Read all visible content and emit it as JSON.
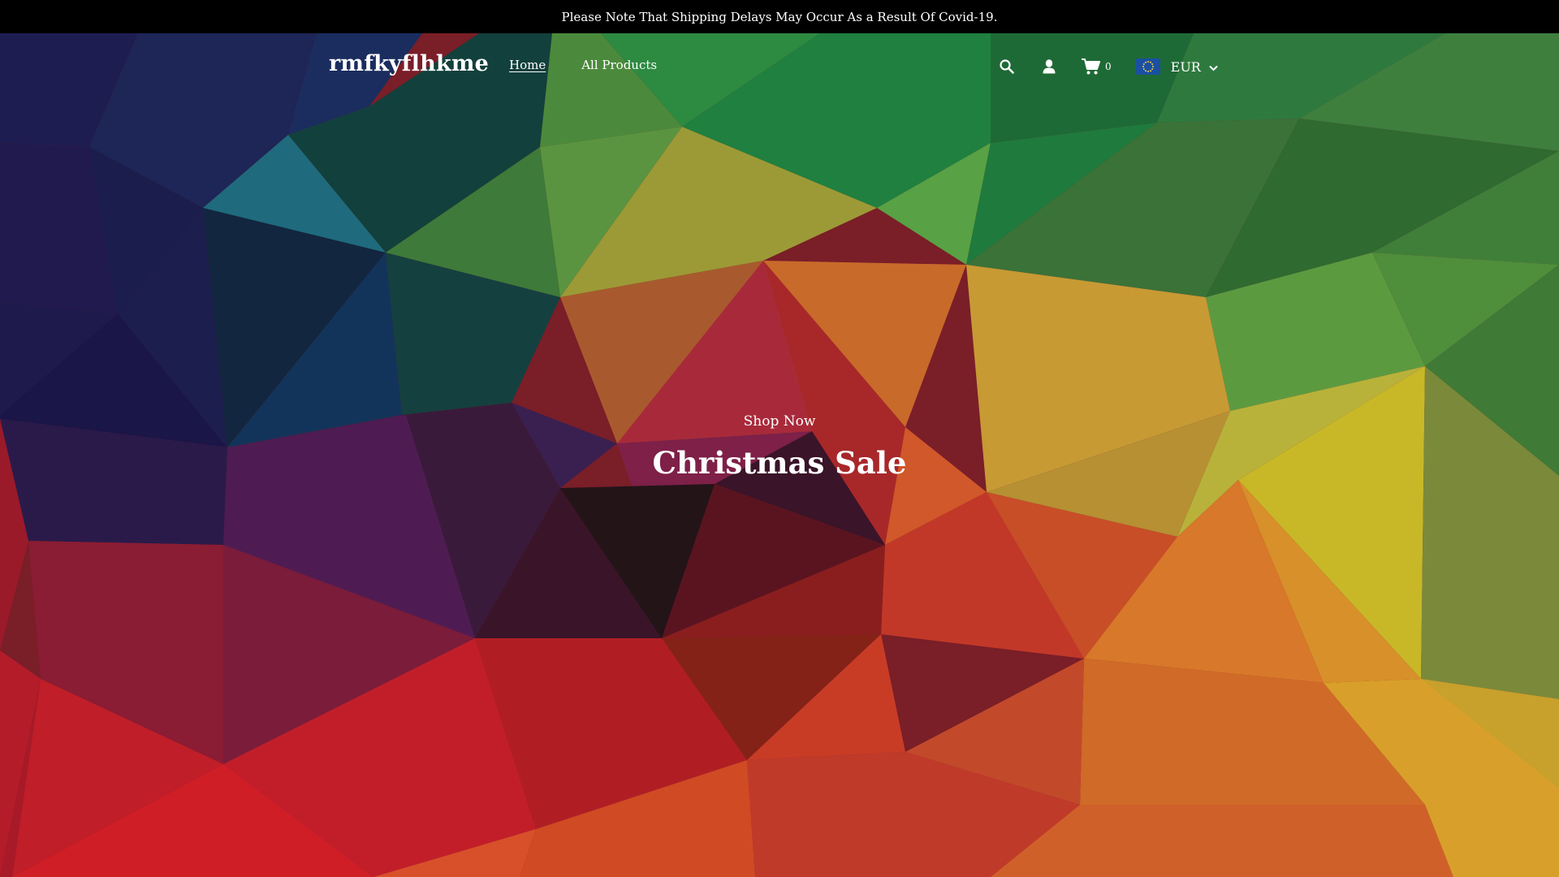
{
  "announcement": {
    "text": "Please Note That Shipping Delays May Occur As a Result Of Covid-19."
  },
  "header": {
    "logo": "rmfkyflhkme",
    "nav": [
      {
        "label": "Home",
        "active": true
      },
      {
        "label": "All Products",
        "active": false
      }
    ],
    "icons": [
      "search-icon",
      "user-icon",
      "cart-icon"
    ],
    "cart_count": "0",
    "currency": {
      "code": "EUR",
      "flag": "eu-flag-icon"
    }
  },
  "hero": {
    "kicker": "Shop Now",
    "title": "Christmas Sale"
  },
  "colors": {
    "announcement_bg": "#000000",
    "text": "#ffffff",
    "eu_blue": "#1b4fa2"
  }
}
